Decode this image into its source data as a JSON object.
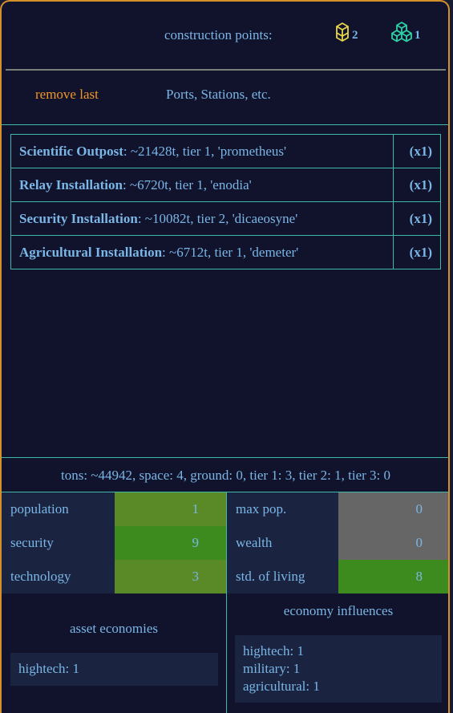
{
  "header": {
    "construction_label": "construction points:",
    "points": [
      {
        "icon": "single-cube-icon",
        "count": "2",
        "color": "#e8d64a"
      },
      {
        "icon": "multi-cube-icon",
        "count": "1",
        "color": "#2fd0a8"
      }
    ]
  },
  "toolbar": {
    "remove_last_label": "remove last",
    "category_label": "Ports, Stations, etc."
  },
  "builds": [
    {
      "name": "Scientific Outpost",
      "detail": ": ~21428t, tier 1, 'prometheus'",
      "qty": "(x1)"
    },
    {
      "name": "Relay Installation",
      "detail": ": ~6720t, tier 1, 'enodia'",
      "qty": "(x1)"
    },
    {
      "name": "Security Installation",
      "detail": ": ~10082t, tier 2, 'dicaeosyne'",
      "qty": "(x1)"
    },
    {
      "name": "Agricultural Installation",
      "detail": ": ~6712t, tier 1, 'demeter'",
      "qty": "(x1)"
    }
  ],
  "summary": "tons: ~44942, space: 4, ground: 0, tier 1: 3, tier 2: 1, tier 3: 0",
  "stats": {
    "left": [
      {
        "label": "population",
        "value": "1",
        "color": "#5a8a28"
      },
      {
        "label": "security",
        "value": "9",
        "color": "#3d8a1e"
      },
      {
        "label": "technology",
        "value": "3",
        "color": "#5a8a28"
      }
    ],
    "right": [
      {
        "label": "max pop.",
        "value": "0",
        "color": "#666666"
      },
      {
        "label": "wealth",
        "value": "0",
        "color": "#666666"
      },
      {
        "label": "std. of living",
        "value": "8",
        "color": "#3d8a1e"
      }
    ]
  },
  "asset_economies": {
    "title": "asset economies",
    "items": [
      "hightech: 1"
    ]
  },
  "economy_influences": {
    "title": "economy influences",
    "items": [
      "hightech: 1",
      "military: 1",
      "agricultural: 1"
    ]
  },
  "colors": {
    "accent_orange": "#f0962a",
    "border_teal": "#3fb8a6",
    "text_blue": "#7ab6e6",
    "background": "#11122b"
  }
}
